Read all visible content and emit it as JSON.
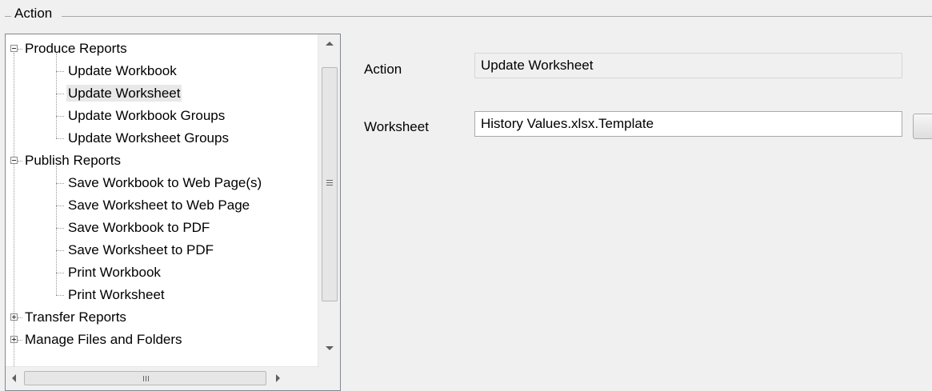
{
  "group": {
    "title": "Action"
  },
  "tree": {
    "items": [
      {
        "label": "Produce Reports",
        "level": 0,
        "expander": "minus"
      },
      {
        "label": "Update Workbook",
        "level": 1
      },
      {
        "label": "Update Worksheet",
        "level": 1,
        "selected": true
      },
      {
        "label": "Update Workbook Groups",
        "level": 1
      },
      {
        "label": "Update Worksheet Groups",
        "level": 1
      },
      {
        "label": "Publish Reports",
        "level": 0,
        "expander": "minus"
      },
      {
        "label": "Save Workbook to Web Page(s)",
        "level": 1
      },
      {
        "label": "Save Worksheet to Web Page",
        "level": 1
      },
      {
        "label": "Save Workbook to PDF",
        "level": 1
      },
      {
        "label": "Save Worksheet to PDF",
        "level": 1
      },
      {
        "label": "Print Workbook",
        "level": 1
      },
      {
        "label": "Print Worksheet",
        "level": 1
      },
      {
        "label": "Transfer Reports",
        "level": 0,
        "expander": "plus"
      },
      {
        "label": "Manage Files and Folders",
        "level": 0,
        "expander": "plus"
      }
    ]
  },
  "form": {
    "action_label": "Action",
    "action_value": "Update Worksheet",
    "worksheet_label": "Worksheet",
    "worksheet_value": "History Values.xlsx.Template"
  },
  "colors": {
    "window_bg": "#f0f0f0",
    "tree_border": "#828790",
    "selection_bg": "#e8e8e8"
  },
  "icons": {
    "scroll_up": "triangle-up-icon",
    "scroll_down": "triangle-down-icon",
    "scroll_left": "triangle-left-icon",
    "scroll_right": "triangle-right-icon",
    "expand": "plus-box-icon",
    "collapse": "minus-box-icon"
  }
}
